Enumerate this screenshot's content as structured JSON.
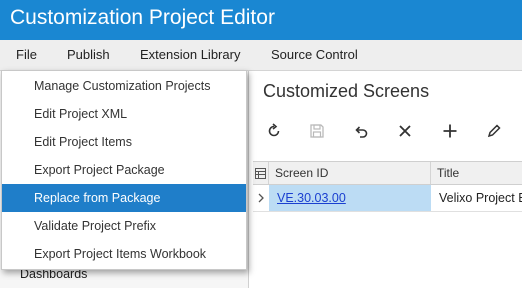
{
  "window": {
    "title": "Customization Project Editor"
  },
  "menubar": {
    "items": [
      "File",
      "Publish",
      "Extension Library",
      "Source Control"
    ]
  },
  "file_menu": {
    "items": [
      "Manage Customization Projects",
      "Edit Project XML",
      "Edit Project Items",
      "Export Project Package",
      "Replace from Package",
      "Validate Project Prefix",
      "Export Project Items Workbook"
    ],
    "highlighted": "Replace from Package"
  },
  "sidebar": {
    "items": [
      "Dashboards"
    ]
  },
  "main": {
    "title": "Customized Screens",
    "toolbar": {
      "icons": [
        "refresh-icon",
        "save-icon",
        "undo-icon",
        "delete-icon",
        "add-icon",
        "edit-icon"
      ]
    },
    "grid": {
      "columns": [
        "Screen ID",
        "Title"
      ],
      "rows": [
        {
          "screen_id": "VE.30.03.00",
          "title": "Velixo Project E"
        }
      ]
    }
  },
  "colors": {
    "titlebar": "#1a87d2",
    "menu_highlight": "#1f7ec9",
    "selected_row": "#bcdcf4",
    "link": "#1a3fd0"
  }
}
